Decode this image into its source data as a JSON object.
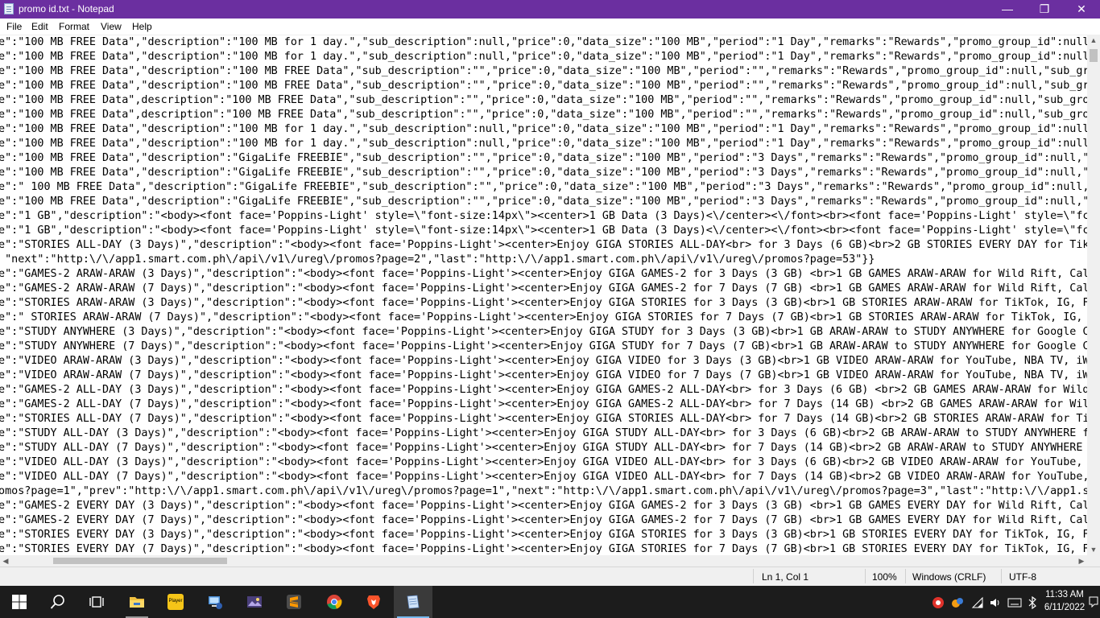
{
  "window": {
    "title": "promo id.txt - Notepad",
    "controls": {
      "minimize": "—",
      "maximize": "❐",
      "close": "✕"
    }
  },
  "menu": [
    "File",
    "Edit",
    "Format",
    "View",
    "Help"
  ],
  "editor": {
    "lines": [
      "me\":\"100 MB FREE Data\",\"description\":\"100 MB for 1 day.\",\"sub_description\":null,\"price\":0,\"data_size\":\"100 MB\",\"period\":\"1 Day\",\"remarks\":\"Rewards\",\"promo_group_id\":null",
      "me\":\"100 MB FREE Data\",\"description\":\"100 MB for 1 day.\",\"sub_description\":null,\"price\":0,\"data_size\":\"100 MB\",\"period\":\"1 Day\",\"remarks\":\"Rewards\",\"promo_group_id\":null",
      "me\":\"100 MB FREE Data\",\"description\":\"100 MB FREE Data\",\"sub_description\":\"\",\"price\":0,\"data_size\":\"100 MB\",\"period\":\"\",\"remarks\":\"Rewards\",\"promo_group_id\":null,\"sub_gr",
      "me\":\"100 MB FREE Data\",\"description\":\"100 MB FREE Data\",\"sub_description\":\"\",\"price\":0,\"data_size\":\"100 MB\",\"period\":\"\",\"remarks\":\"Rewards\",\"promo_group_id\":null,\"sub_gr",
      "me\":\"100 MB FREE Data\",description\":\"100 MB FREE Data\",\"sub_description\":\"\",\"price\":0,\"data_size\":\"100 MB\",\"period\":\"\",\"remarks\":\"Rewards\",\"promo_group_id\":null,\"sub_gro",
      "me\":\"100 MB FREE Data\",description\":\"100 MB FREE Data\",\"sub_description\":\"\",\"price\":0,\"data_size\":\"100 MB\",\"period\":\"\",\"remarks\":\"Rewards\",\"promo_group_id\":null,\"sub_gro",
      "me\":\"100 MB FREE Data\",\"description\":\"100 MB for 1 day.\",\"sub_description\":null,\"price\":0,\"data_size\":\"100 MB\",\"period\":\"1 Day\",\"remarks\":\"Rewards\",\"promo_group_id\":null",
      "me\":\"100 MB FREE Data\",\"description\":\"100 MB for 1 day.\",\"sub_description\":null,\"price\":0,\"data_size\":\"100 MB\",\"period\":\"1 Day\",\"remarks\":\"Rewards\",\"promo_group_id\":null",
      "me\":\"100 MB FREE Data\",\"description\":\"GigaLife FREEBIE\",\"sub_description\":\"\",\"price\":0,\"data_size\":\"100 MB\",\"period\":\"3 Days\",\"remarks\":\"Rewards\",\"promo_group_id\":null,\"",
      "me\":\"100 MB FREE Data\",\"description\":\"GigaLife FREEBIE\",\"sub_description\":\"\",\"price\":0,\"data_size\":\"100 MB\",\"period\":\"3 Days\",\"remarks\":\"Rewards\",\"promo_group_id\":null,\"",
      "me\":\" 100 MB FREE Data\",\"description\":\"GigaLife FREEBIE\",\"sub_description\":\"\",\"price\":0,\"data_size\":\"100 MB\",\"period\":\"3 Days\",\"remarks\":\"Rewards\",\"promo_group_id\":null,",
      "me\":\"100 MB FREE Data\",\"description\":\"GigaLife FREEBIE\",\"sub_description\":\"\",\"price\":0,\"data_size\":\"100 MB\",\"period\":\"3 Days\",\"remarks\":\"Rewards\",\"promo_group_id\":null,\"",
      "me\":\"1 GB\",\"description\":\"<body><font face='Poppins-Light' style=\\\"font-size:14px\\\"><center>1 GB Data (3 Days)<\\/center><\\/font><br><font face='Poppins-Light' style=\\\"fc",
      "me\":\"1 GB\",\"description\":\"<body><font face='Poppins-Light' style=\\\"font-size:14px\\\"><center>1 GB Data (3 Days)<\\/center><\\/font><br><font face='Poppins-Light' style=\\\"fc",
      "me\":\"STORIES ALL-DAY (3 Days)\",\"description\":\"<body><font face='Poppins-Light'><center>Enjoy GIGA STORIES ALL-DAY<br> for 3 Days (6 GB)<br>2 GB STORIES EVERY DAY for Tik",
      "  \"next\":\"http:\\/\\/app1.smart.com.ph\\/api\\/v1\\/ureg\\/promos?page=2\",\"last\":\"http:\\/\\/app1.smart.com.ph\\/api\\/v1\\/ureg\\/promos?page=53\"}}",
      "me\":\"GAMES-2 ARAW-ARAW (3 Days)\",\"description\":\"<body><font face='Poppins-Light'><center>Enjoy GIGA GAMES-2 for 3 Days (3 GB) <br>1 GB GAMES ARAW-ARAW for Wild Rift, Cal",
      "me\":\"GAMES-2 ARAW-ARAW (7 Days)\",\"description\":\"<body><font face='Poppins-Light'><center>Enjoy GIGA GAMES-2 for 7 Days (7 GB) <br>1 GB GAMES ARAW-ARAW for Wild Rift, Cal",
      "me\":\"STORIES ARAW-ARAW (3 Days)\",\"description\":\"<body><font face='Poppins-Light'><center>Enjoy GIGA STORIES for 3 Days (3 GB)<br>1 GB STORIES ARAW-ARAW for TikTok, IG, F",
      "me\":\" STORIES ARAW-ARAW (7 Days)\",\"description\":\"<body><font face='Poppins-Light'><center>Enjoy GIGA STORIES for 7 Days (7 GB)<br>1 GB STORIES ARAW-ARAW for TikTok, IG,",
      "me\":\"STUDY ANYWHERE (3 Days)\",\"description\":\"<body><font face='Poppins-Light'><center>Enjoy GIGA STUDY for 3 Days (3 GB)<br>1 GB ARAW-ARAW to STUDY ANYWHERE for Google C",
      "me\":\"STUDY ANYWHERE (7 Days)\",\"description\":\"<body><font face='Poppins-Light'><center>Enjoy GIGA STUDY for 7 Days (7 GB)<br>1 GB ARAW-ARAW to STUDY ANYWHERE for Google C",
      "me\":\"VIDEO ARAW-ARAW (3 Days)\",\"description\":\"<body><font face='Poppins-Light'><center>Enjoy GIGA VIDEO for 3 Days (3 GB)<br>1 GB VIDEO ARAW-ARAW for YouTube, NBA TV, iW",
      "me\":\"VIDEO ARAW-ARAW (7 Days)\",\"description\":\"<body><font face='Poppins-Light'><center>Enjoy GIGA VIDEO for 7 Days (7 GB)<br>1 GB VIDEO ARAW-ARAW for YouTube, NBA TV, iW",
      "me\":\"GAMES-2 ALL-DAY (3 Days)\",\"description\":\"<body><font face='Poppins-Light'><center>Enjoy GIGA GAMES-2 ALL-DAY<br> for 3 Days (6 GB) <br>2 GB GAMES ARAW-ARAW for Wild",
      "me\":\"GAMES-2 ALL-DAY (7 Days)\",\"description\":\"<body><font face='Poppins-Light'><center>Enjoy GIGA GAMES-2 ALL-DAY<br> for 7 Days (14 GB) <br>2 GB GAMES ARAW-ARAW for Wil",
      "me\":\"STORIES ALL-DAY (7 Days)\",\"description\":\"<body><font face='Poppins-Light'><center>Enjoy GIGA STORIES ALL-DAY<br> for 7 Days (14 GB)<br>2 GB STORIES ARAW-ARAW for Ti",
      "me\":\"STUDY ALL-DAY (3 Days)\",\"description\":\"<body><font face='Poppins-Light'><center>Enjoy GIGA STUDY ALL-DAY<br> for 3 Days (6 GB)<br>2 GB ARAW-ARAW to STUDY ANYWHERE f",
      "me\":\"STUDY ALL-DAY (7 Days)\",\"description\":\"<body><font face='Poppins-Light'><center>Enjoy GIGA STUDY ALL-DAY<br> for 7 Days (14 GB)<br>2 GB ARAW-ARAW to STUDY ANYWHERE",
      "me\":\"VIDEO ALL-DAY (3 Days)\",\"description\":\"<body><font face='Poppins-Light'><center>Enjoy GIGA VIDEO ALL-DAY<br> for 3 Days (6 GB)<br>2 GB VIDEO ARAW-ARAW for YouTube,",
      "me\":\"VIDEO ALL-DAY (7 Days)\",\"description\":\"<body><font face='Poppins-Light'><center>Enjoy GIGA VIDEO ALL-DAY<br> for 7 Days (14 GB)<br>2 GB VIDEO ARAW-ARAW for YouTube,",
      "romos?page=1\",\"prev\":\"http:\\/\\/app1.smart.com.ph\\/api\\/v1\\/ureg\\/promos?page=1\",\"next\":\"http:\\/\\/app1.smart.com.ph\\/api\\/v1\\/ureg\\/promos?page=3\",\"last\":\"http:\\/\\/app1.s",
      "me\":\"GAMES-2 EVERY DAY (3 Days)\",\"description\":\"<body><font face='Poppins-Light'><center>Enjoy GIGA GAMES-2 for 3 Days (3 GB) <br>1 GB GAMES EVERY DAY for Wild Rift, Cal",
      "me\":\"GAMES-2 EVERY DAY (7 Days)\",\"description\":\"<body><font face='Poppins-Light'><center>Enjoy GIGA GAMES-2 for 7 Days (7 GB) <br>1 GB GAMES EVERY DAY for Wild Rift, Cal",
      "me\":\"STORIES EVERY DAY (3 Days)\",\"description\":\"<body><font face='Poppins-Light'><center>Enjoy GIGA STORIES for 3 Days (3 GB)<br>1 GB STORIES EVERY DAY for TikTok, IG, F",
      "me\":\"STORIES EVERY DAY (7 Days)\",\"description\":\"<body><font face='Poppins-Light'><center>Enjoy GIGA STORIES for 7 Days (7 GB)<br>1 GB STORIES EVERY DAY for TikTok, IG, F"
    ]
  },
  "statusbar": {
    "position": "Ln 1, Col 1",
    "zoom": "100%",
    "line_ending": "Windows (CRLF)",
    "encoding": "UTF-8"
  },
  "taskbar": {
    "apps": [
      {
        "name": "file-explorer-icon",
        "color": "#f0c040",
        "active": false
      },
      {
        "name": "player-icon",
        "color": "#f5c518",
        "active": false
      },
      {
        "name": "network-tool-icon",
        "color": "#4a8fd8",
        "active": false
      },
      {
        "name": "photo-app-icon",
        "color": "#6b5fa8",
        "active": false
      },
      {
        "name": "sublime-text-icon",
        "color": "#ff9800",
        "active": false
      },
      {
        "name": "chrome-icon",
        "color": "#4caf50",
        "active": false
      },
      {
        "name": "brave-icon",
        "color": "#fb542b",
        "active": false
      },
      {
        "name": "notepad-icon",
        "color": "#8fb7e8",
        "active": true
      }
    ],
    "player_label": "Player",
    "clock": {
      "time": "11:33 AM",
      "date": "6/11/2022"
    }
  }
}
